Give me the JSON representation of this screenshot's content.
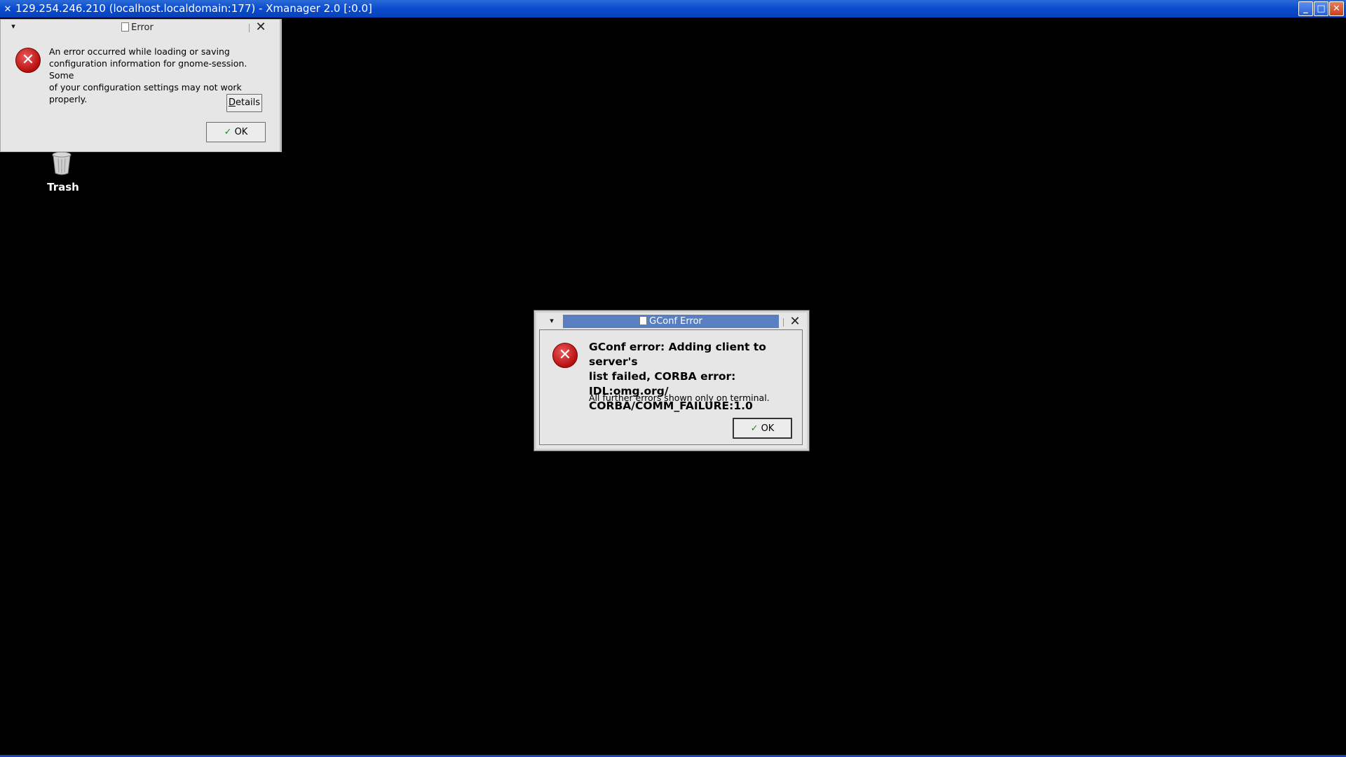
{
  "outer_window": {
    "title": "129.254.246.210 (localhost.localdomain:177) - Xmanager 2.0 [:0.0]",
    "buttons": {
      "minimize": "_",
      "maximize": "□",
      "close": "✕"
    }
  },
  "desktop": {
    "trash_label": "Trash"
  },
  "error_dialog": {
    "title": "Error",
    "message_lines": [
      "An error occurred while loading or saving",
      "configuration information for gnome-session. Some",
      "of your configuration settings may not work properly."
    ],
    "details_button": "Details",
    "ok_button": "OK"
  },
  "gconf_dialog": {
    "title": "GConf Error",
    "headline_lines": [
      "GConf error: Adding client to server's",
      "list failed, CORBA error: IDL:omg.org/",
      "CORBA/COMM_FAILURE:1.0"
    ],
    "detail": "All further errors shown only on terminal.",
    "ok_button": "OK"
  },
  "colors": {
    "desktop_bg": "#000000",
    "titlebar_blue": "#0a4bd0",
    "gconf_titlebar": "#5a7fc0",
    "dialog_bg": "#e6e6e6",
    "error_red": "#c01515"
  }
}
